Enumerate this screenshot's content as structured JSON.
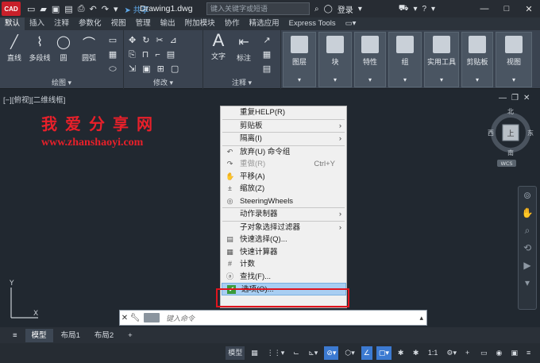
{
  "app": {
    "logo_text": "CAD",
    "share": "共享",
    "doc_title": "Drawing1.dwg",
    "search_placeholder": "键入关键字或短语",
    "login": "登录"
  },
  "tabs": [
    "默认",
    "插入",
    "注释",
    "参数化",
    "视图",
    "管理",
    "输出",
    "附加模块",
    "协作",
    "精选应用",
    "Express Tools"
  ],
  "ribbon": {
    "draw": {
      "line": "直线",
      "polyline": "多段线",
      "circle": "圆",
      "arc": "圆弧",
      "group_label": "绘图"
    },
    "modify": {
      "group_label": "修改"
    },
    "annotation": {
      "text": "文字",
      "dimension": "标注",
      "group_label": "注释"
    },
    "panels": [
      "图层",
      "块",
      "特性",
      "组",
      "实用工具",
      "剪贴板",
      "视图"
    ]
  },
  "viewport": {
    "label": "[−][俯视][二维线框]",
    "watermark_title": "我爱分享网",
    "watermark_url": "www.zhanshaoyi.com"
  },
  "compass": {
    "north": "北",
    "south": "南",
    "east": "东",
    "west": "西",
    "top": "上",
    "wcs": "WCS"
  },
  "context_menu": [
    {
      "label": "重复HELP(R)",
      "icon": "",
      "shortcut": "",
      "sub": false,
      "disabled": false
    },
    {
      "sep": true
    },
    {
      "label": "剪贴板",
      "icon": "",
      "shortcut": "",
      "sub": true,
      "disabled": false
    },
    {
      "sep": true
    },
    {
      "label": "隔离(I)",
      "icon": "",
      "shortcut": "",
      "sub": true,
      "disabled": false
    },
    {
      "sep": true
    },
    {
      "label": "放弃(U) 命令组",
      "icon": "undo-icon",
      "shortcut": "",
      "sub": false,
      "disabled": false
    },
    {
      "label": "重做(R)",
      "icon": "redo-icon",
      "shortcut": "Ctrl+Y",
      "sub": false,
      "disabled": true
    },
    {
      "label": "平移(A)",
      "icon": "pan-icon",
      "shortcut": "",
      "sub": false,
      "disabled": false
    },
    {
      "label": "缩放(Z)",
      "icon": "zoom-icon",
      "shortcut": "",
      "sub": false,
      "disabled": false
    },
    {
      "label": "SteeringWheels",
      "icon": "wheel-icon",
      "shortcut": "",
      "sub": false,
      "disabled": false
    },
    {
      "sep": true
    },
    {
      "label": "动作录制器",
      "icon": "",
      "shortcut": "",
      "sub": true,
      "disabled": false
    },
    {
      "sep": true
    },
    {
      "label": "子对象选择过滤器",
      "icon": "",
      "shortcut": "",
      "sub": true,
      "disabled": false
    },
    {
      "label": "快速选择(Q)...",
      "icon": "quick-select-icon",
      "shortcut": "",
      "sub": false,
      "disabled": false
    },
    {
      "label": "快速计算器",
      "icon": "calculator-icon",
      "shortcut": "",
      "sub": false,
      "disabled": false
    },
    {
      "label": "计数",
      "icon": "count-icon",
      "shortcut": "",
      "sub": false,
      "disabled": false
    },
    {
      "label": "查找(F)...",
      "icon": "find-icon",
      "shortcut": "",
      "sub": false,
      "disabled": false
    },
    {
      "label": "选项(O)...",
      "icon": "options-check-icon",
      "shortcut": "",
      "sub": false,
      "disabled": false,
      "highlight": true
    }
  ],
  "command": {
    "placeholder": "键入命令"
  },
  "layouts": [
    "模型",
    "布局1",
    "布局2"
  ],
  "status": {
    "model": "模型",
    "scale": "1:1"
  }
}
